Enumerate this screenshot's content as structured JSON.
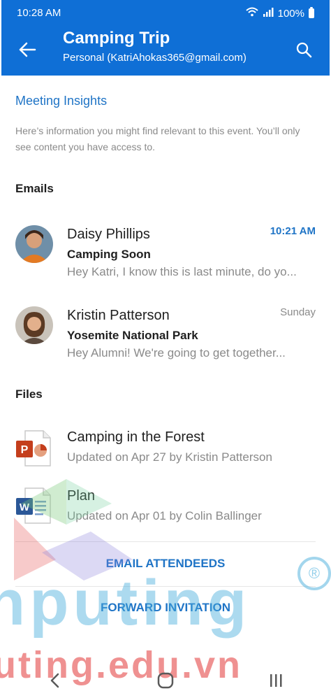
{
  "status": {
    "time": "10:28 AM",
    "battery": "100%"
  },
  "header": {
    "title": "Camping Trip",
    "subtitle": "Personal (KatriAhokas365@gmail.com)"
  },
  "insights": {
    "title": "Meeting Insights",
    "description": "Here’s information you might find relevant to this event. You’ll only see content you have access to."
  },
  "emails": {
    "heading": "Emails",
    "items": [
      {
        "sender": "Daisy Phillips",
        "subject": "Camping Soon",
        "preview": "Hey Katri, I know this is last minute, do yo...",
        "time": "10:21 AM"
      },
      {
        "sender": "Kristin Patterson",
        "subject": "Yosemite National Park",
        "preview": "Hey Alumni! We're going to get together...",
        "time": "Sunday"
      }
    ]
  },
  "files": {
    "heading": "Files",
    "items": [
      {
        "name": "Camping in the Forest",
        "meta": "Updated on Apr 27 by Kristin Patterson",
        "icon": "powerpoint-icon",
        "icon_letter": "P"
      },
      {
        "name": "Plan",
        "meta": "Updated on Apr 01 by Colin Ballinger",
        "icon": "word-icon",
        "icon_letter": "W"
      }
    ]
  },
  "actions": {
    "email_attendees": "EMAIL ATTENDEEDS",
    "forward_invitation": "FORWARD INVITATION"
  },
  "watermark": {
    "brand": "nputing",
    "domain": "uting.edu.vn",
    "reg": "®"
  },
  "colors": {
    "header": "#0f6fd6",
    "accent": "#1f74c6",
    "muted": "#8a8a8a"
  }
}
